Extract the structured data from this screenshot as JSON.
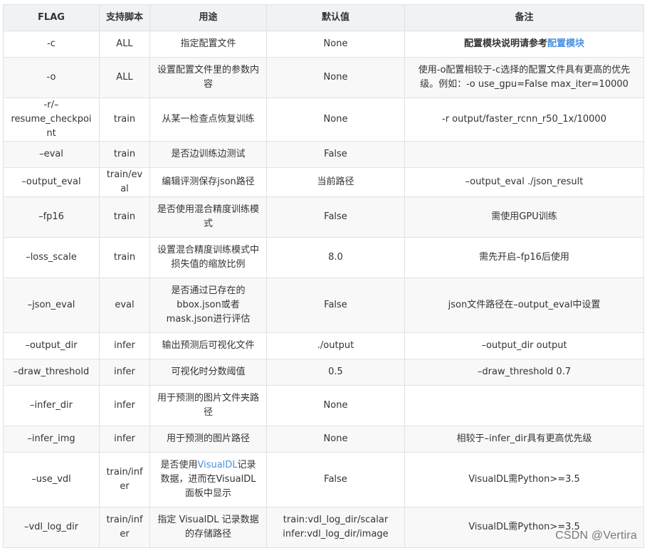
{
  "headers": {
    "flag": "FLAG",
    "script": "支持脚本",
    "usage": "用途",
    "default": "默认值",
    "note": "备注"
  },
  "rows": [
    {
      "flag": "-c",
      "script": "ALL",
      "usage": "指定配置文件",
      "default": "None",
      "note_prefix": "配置模块说明请参考",
      "note_link": "配置模块",
      "note": ""
    },
    {
      "flag": "-o",
      "script": "ALL",
      "usage": "设置配置文件里的参数内容",
      "default": "None",
      "note": "使用-o配置相较于-c选择的配置文件具有更高的优先级。例如：-o use_gpu=False max_iter=10000"
    },
    {
      "flag": "-r/–resume_checkpoint",
      "script": "train",
      "usage": "从某一检查点恢复训练",
      "default": "None",
      "note": "-r output/faster_rcnn_r50_1x/10000"
    },
    {
      "flag": "–eval",
      "script": "train",
      "usage": "是否边训练边测试",
      "default": "False",
      "note": ""
    },
    {
      "flag": "–output_eval",
      "script": "train/eval",
      "usage": "编辑评测保存json路径",
      "default": "当前路径",
      "note": "–output_eval ./json_result"
    },
    {
      "flag": "–fp16",
      "script": "train",
      "usage": "是否使用混合精度训练模式",
      "default": "False",
      "note": "需使用GPU训练"
    },
    {
      "flag": "–loss_scale",
      "script": "train",
      "usage": "设置混合精度训练模式中损失值的缩放比例",
      "default": "8.0",
      "note": "需先开启–fp16后使用"
    },
    {
      "flag": "–json_eval",
      "script": "eval",
      "usage": "是否通过已存在的bbox.json或者mask.json进行评估",
      "default": "False",
      "note": "json文件路径在–output_eval中设置"
    },
    {
      "flag": "–output_dir",
      "script": "infer",
      "usage": "输出预测后可视化文件",
      "default": "./output",
      "note": "–output_dir output"
    },
    {
      "flag": "–draw_threshold",
      "script": "infer",
      "usage": "可视化时分数阈值",
      "default": "0.5",
      "note": "–draw_threshold 0.7"
    },
    {
      "flag": "–infer_dir",
      "script": "infer",
      "usage": "用于预测的图片文件夹路径",
      "default": "None",
      "note": ""
    },
    {
      "flag": "–infer_img",
      "script": "infer",
      "usage": "用于预测的图片路径",
      "default": "None",
      "note": "相较于–infer_dir具有更高优先级"
    },
    {
      "flag": "–use_vdl",
      "script": "train/infer",
      "usage_prefix": "是否使用",
      "usage_link": "VisualDL",
      "usage_suffix": "记录数据，进而在VisualDL面板中显示",
      "default": "False",
      "note": "VisualDL需Python>=3.5"
    },
    {
      "flag": "–vdl_log_dir",
      "script": "train/infer",
      "usage": "指定 VisualDL 记录数据的存储路径",
      "default_line1": "train:vdl_log_dir/scalar",
      "default_line2": "infer:vdl_log_dir/image",
      "note": "VisualDL需Python>=3.5"
    }
  ],
  "watermark": "CSDN @Vertira"
}
